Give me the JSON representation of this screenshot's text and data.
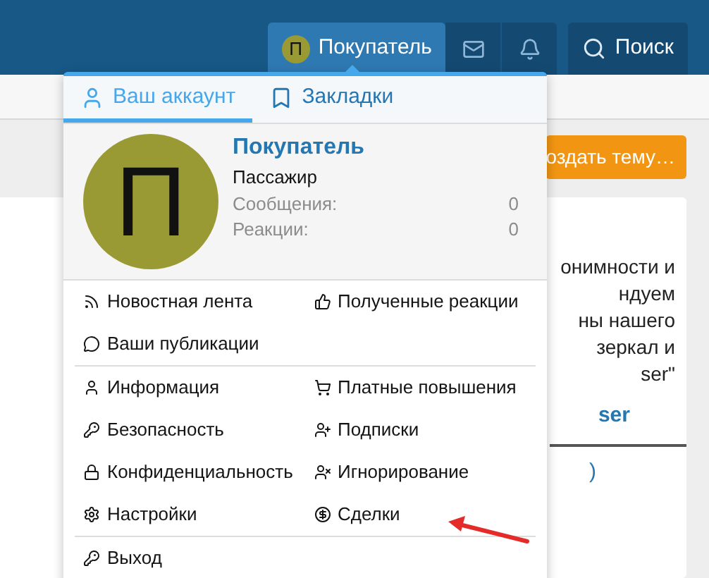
{
  "header": {
    "user": {
      "avatar_letter": "П",
      "name": "Покупатель",
      "selected": true
    },
    "search": {
      "label": "Поиск"
    }
  },
  "background": {
    "button": "оздать тему…",
    "text_lines": [
      "онимности и",
      "ндуем",
      "ны нашего",
      "зеркал и",
      "ser\""
    ],
    "link": "ser",
    "link_2": ")"
  },
  "menu": {
    "tabs": [
      {
        "label": "Ваш аккаунт",
        "selected": true
      },
      {
        "label": "Закладки",
        "selected": false
      }
    ],
    "profile": {
      "avatar_letter": "П",
      "name": "Покупатель",
      "title": "Пассажир",
      "stats": [
        {
          "label": "Сообщения:",
          "value": "0"
        },
        {
          "label": "Реакции:",
          "value": "0"
        }
      ]
    },
    "groups": [
      [
        "Новостная лента",
        "Полученные реакции",
        "Ваши публикации"
      ],
      [
        "Информация",
        "Платные повышения",
        "Безопасность",
        "Подписки",
        "Конфиденциальность",
        "Игнорирование",
        "Настройки",
        "Сделки"
      ],
      [
        "Выход"
      ]
    ]
  }
}
